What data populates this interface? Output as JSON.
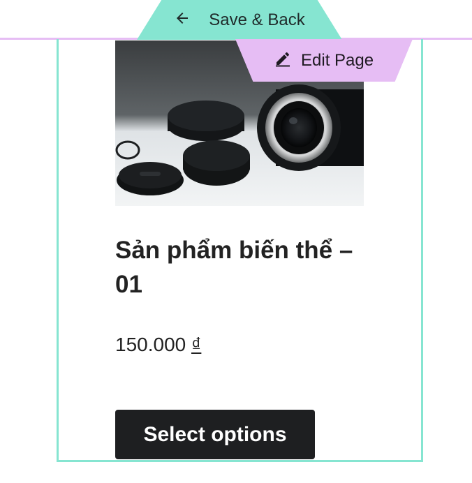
{
  "toolbar": {
    "save_back_label": "Save & Back",
    "edit_page_label": "Edit Page",
    "colors": {
      "save_back": "#86e5d1",
      "edit_page": "#e6bdf4"
    }
  },
  "product": {
    "title": "Sản phẩm biến thể – 01",
    "price_amount": "150.000",
    "price_currency": "₫",
    "button_label": "Select options"
  },
  "icons": {
    "save_back": "arrow-left-icon",
    "edit_page": "pencil-icon"
  }
}
